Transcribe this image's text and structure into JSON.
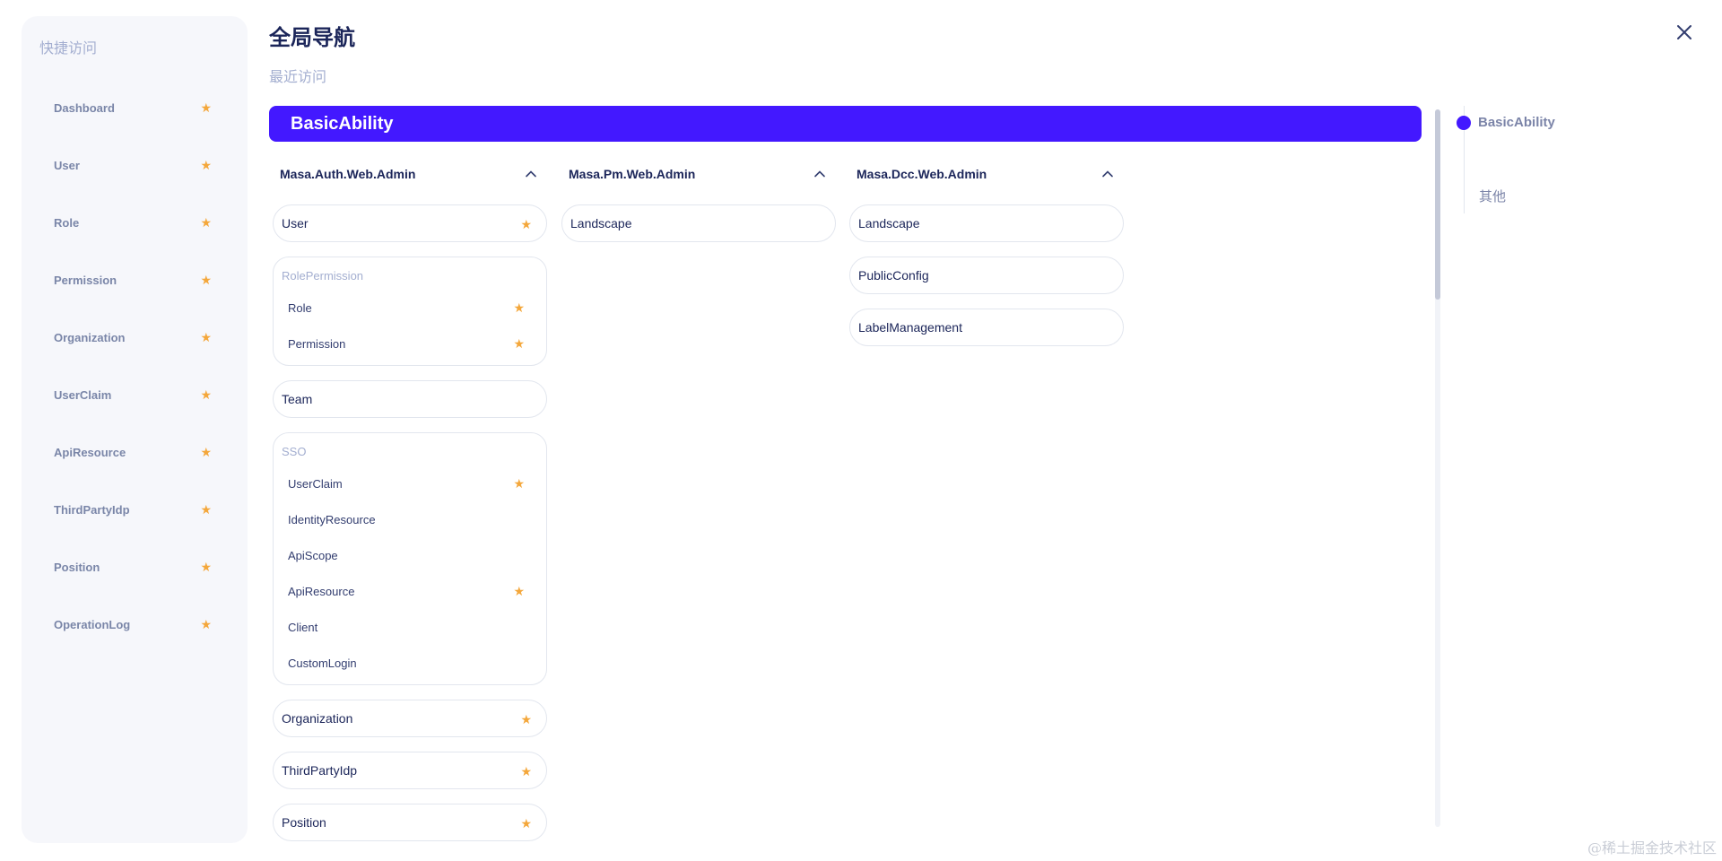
{
  "quick_access": {
    "title": "快捷访问",
    "items": [
      {
        "label": "Dashboard"
      },
      {
        "label": "User"
      },
      {
        "label": "Role"
      },
      {
        "label": "Permission"
      },
      {
        "label": "Organization"
      },
      {
        "label": "UserClaim"
      },
      {
        "label": "ApiResource"
      },
      {
        "label": "ThirdPartyIdp"
      },
      {
        "label": "Position"
      },
      {
        "label": "OperationLog"
      }
    ]
  },
  "header": {
    "title": "全局导航",
    "recent_label": "最近访问"
  },
  "category": {
    "label": "BasicAbility"
  },
  "columns": [
    {
      "name": "Masa.Auth.Web.Admin",
      "user": "User",
      "role_permission": {
        "title": "RolePermission",
        "role": "Role",
        "permission": "Permission"
      },
      "team": "Team",
      "sso": {
        "title": "SSO",
        "user_claim": "UserClaim",
        "identity_resource": "IdentityResource",
        "api_scope": "ApiScope",
        "api_resource": "ApiResource",
        "client": "Client",
        "custom_login": "CustomLogin"
      },
      "organization": "Organization",
      "third_party_idp": "ThirdPartyIdp",
      "position": "Position"
    },
    {
      "name": "Masa.Pm.Web.Admin",
      "landscape": "Landscape"
    },
    {
      "name": "Masa.Dcc.Web.Admin",
      "landscape": "Landscape",
      "public_config": "PublicConfig",
      "label_management": "LabelManagement"
    }
  ],
  "anchors": [
    {
      "label": "BasicAbility",
      "active": true
    },
    {
      "label": "其他",
      "active": false
    }
  ],
  "watermark": "@稀土掘金技术社区",
  "icons": {
    "star": "star-icon",
    "close": "close-icon",
    "collapse": "chevron-up-icon"
  },
  "colors": {
    "accent": "#4318ff",
    "star": "#f4a73b",
    "sidebar_bg": "#f6f7fb"
  }
}
